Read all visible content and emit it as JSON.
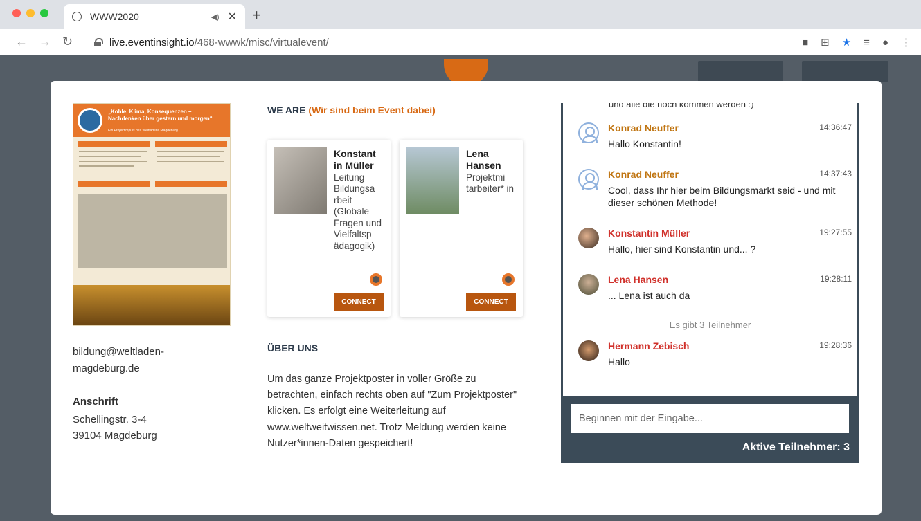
{
  "browser": {
    "tab_title": "WWW2020",
    "url_host": "live.eventinsight.io",
    "url_path": "/468-wwwk/misc/virtualevent/"
  },
  "poster": {
    "title": "„Kohle, Klima, Konsequenzen – Nachdenken über gestern und morgen“",
    "subtitle": "Ein Projektimpuls des Weltladens Magdeburg",
    "logo_text": "Weltladen"
  },
  "contact": {
    "email": "bildung@weltladen-magdeburg.de",
    "address_label": "Anschrift",
    "street": "Schellingstr. 3-4",
    "city": "39104 Magdeburg"
  },
  "we_are": {
    "label": "WE ARE",
    "sublabel": "(Wir sind beim Event dabei)"
  },
  "people": [
    {
      "name": "Konstant in Müller",
      "role": "Leitung Bildungsa rbeit (Globale Fragen und Vielfaltsp ädagogik)",
      "connect": "CONNECT"
    },
    {
      "name": "Lena Hansen",
      "role": "Projektmi tarbeiter* in",
      "connect": "CONNECT"
    }
  ],
  "about": {
    "heading": "ÜBER UNS",
    "text": "Um das ganze Projektposter in voller Größe zu betrachten, einfach rechts oben auf \"Zum Projektposter\" klicken. Es erfolgt eine Weiterleitung auf www.weltweitwissen.net. Trotz Meldung werden keine Nutzer*innen-Daten gespeichert!"
  },
  "chat": {
    "cut_text": "und alle die noch kommen werden :)",
    "messages": [
      {
        "name": "Konrad Neuffer",
        "time": "14:36:47",
        "text": "Hallo Konstantin!",
        "color": "#c07512"
      },
      {
        "name": "Konrad Neuffer",
        "time": "14:37:43",
        "text": "Cool, dass Ihr hier beim Bildungsmarkt seid - und mit dieser schönen Methode!",
        "color": "#c07512"
      },
      {
        "name": "Konstantin Müller",
        "time": "19:27:55",
        "text": "Hallo, hier sind Konstantin und... ?",
        "color": "#d0302a"
      },
      {
        "name": "Lena Hansen",
        "time": "19:28:11",
        "text": "... Lena ist auch da",
        "color": "#d0302a"
      },
      {
        "name": "Hermann Zebisch",
        "time": "19:28:36",
        "text": "Hallo",
        "color": "#d0302a"
      }
    ],
    "system_note": "Es gibt 3 Teilnehmer",
    "input_placeholder": "Beginnen mit der Eingabe...",
    "active_count": "Aktive Teilnehmer: 3"
  },
  "colors": {
    "accent": "#d86a15",
    "connect": "#b8560f",
    "chat_bg": "#3b4b58"
  }
}
